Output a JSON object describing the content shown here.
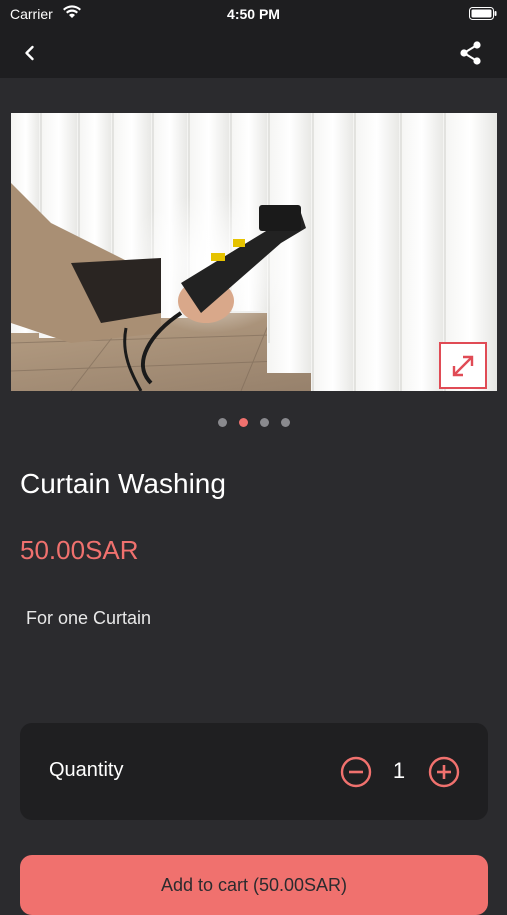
{
  "status_bar": {
    "carrier": "Carrier",
    "time": "4:50 PM"
  },
  "nav": {
    "back_icon": "chevron-left-icon",
    "share_icon": "share-icon"
  },
  "product": {
    "image": "curtain-steam-cleaning-photo",
    "carousel_pages": 4,
    "carousel_active_index": 1,
    "title": "Curtain Washing",
    "price": "50.00SAR",
    "description": "For one Curtain"
  },
  "quantity": {
    "label": "Quantity",
    "value": "1"
  },
  "cart": {
    "add_label": "Add to cart (50.00SAR)"
  },
  "colors": {
    "accent": "#f0716e",
    "background": "#2b2b2e",
    "card": "#1f1f21",
    "bar": "#1e1e20"
  }
}
